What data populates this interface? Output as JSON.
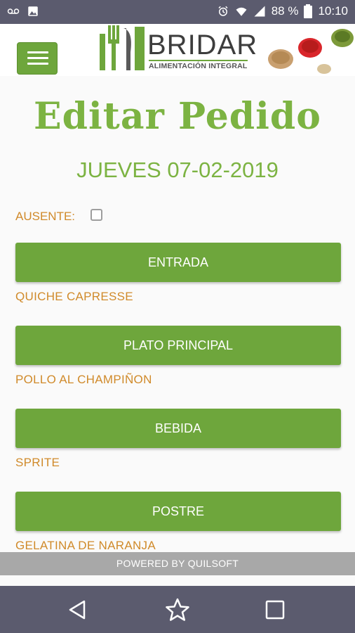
{
  "status_bar": {
    "battery": "88 %",
    "time": "10:10"
  },
  "header": {
    "brand_name": "BRIDAR",
    "brand_tagline": "ALIMENTACIÓN INTEGRAL"
  },
  "main": {
    "title": "Editar Pedido",
    "date": "JUEVES 07-02-2019",
    "absent_label": "AUSENTE:",
    "absent_checked": false,
    "categories": [
      {
        "label": "ENTRADA",
        "value": "QUICHE CAPRESSE"
      },
      {
        "label": "PLATO PRINCIPAL",
        "value": "POLLO AL CHAMPIÑON"
      },
      {
        "label": "BEBIDA",
        "value": "SPRITE"
      },
      {
        "label": "POSTRE",
        "value": "GELATINA DE NARANJA"
      }
    ]
  },
  "footer": {
    "text": "POWERED BY QUILSOFT"
  },
  "colors": {
    "accent": "#6ea63c",
    "title": "#7cb342",
    "value_text": "#d08a2a",
    "status_bar": "#5b5b6e"
  },
  "icons": {
    "status_left": [
      "voicemail-icon",
      "image-icon"
    ],
    "status_right": [
      "alarm-icon",
      "wifi-icon",
      "signal-icon",
      "battery-icon"
    ],
    "nav": [
      "back-icon",
      "star-icon",
      "recents-icon"
    ]
  }
}
